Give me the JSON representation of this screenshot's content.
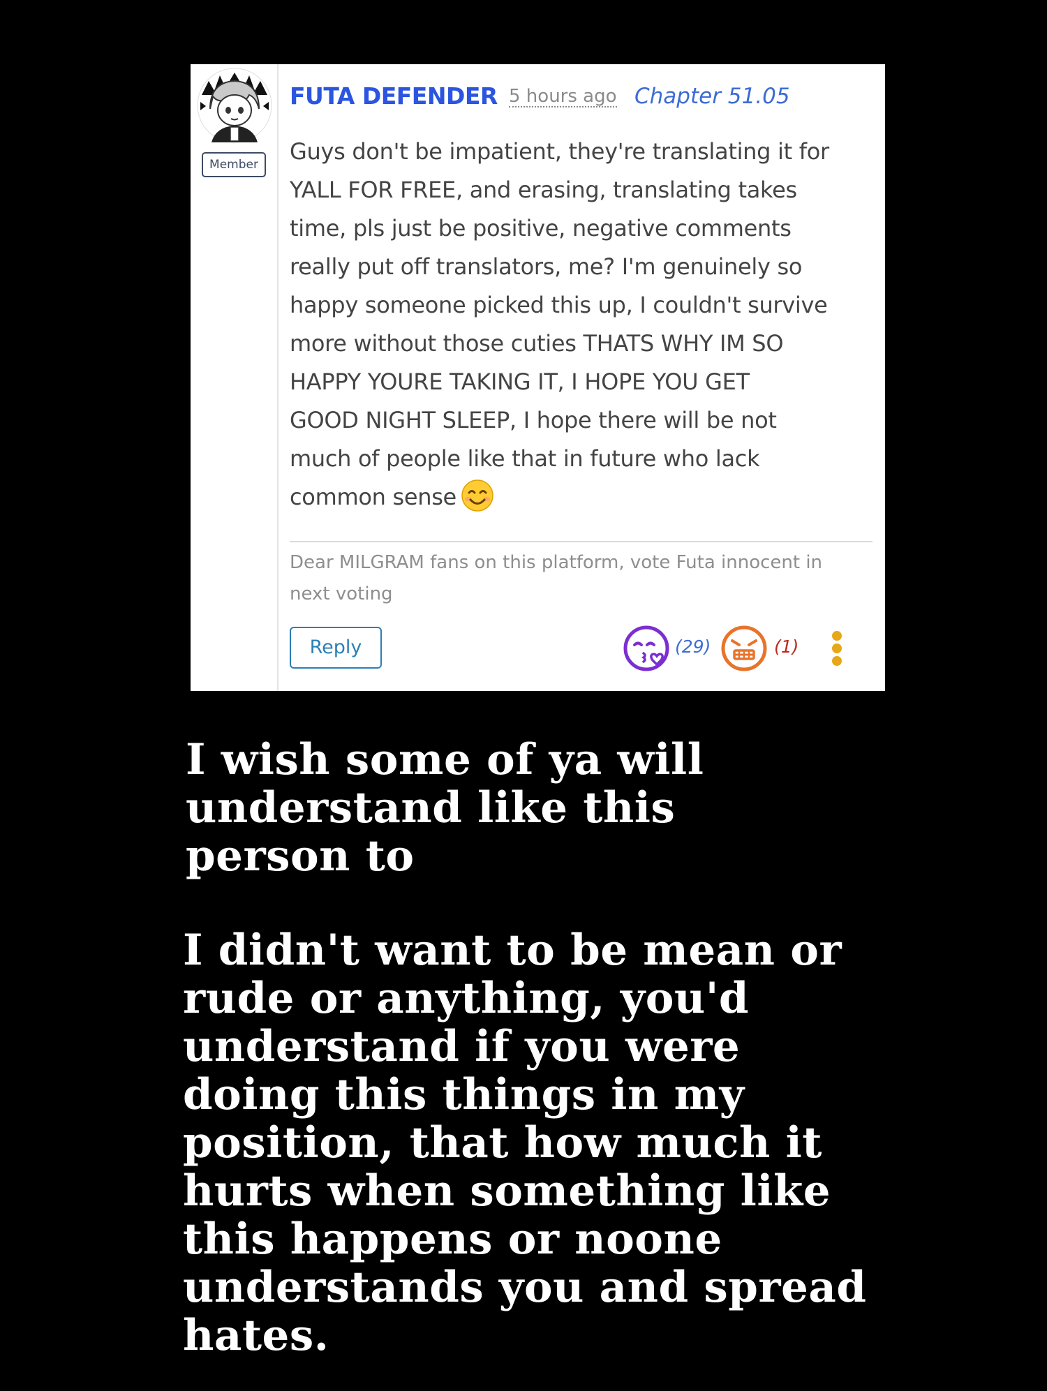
{
  "comment": {
    "username": "FUTA DEFENDER",
    "badge": "Member",
    "timestamp": "5 hours ago",
    "chapter": "Chapter 51.05",
    "body_lines": [
      "Guys don't be impatient, they're translating it for",
      "YALL FOR FREE, and erasing, translating takes",
      "time, pls just be positive, negative comments",
      "really put off translators, me? I'm genuinely so",
      "happy someone picked this up, I couldn't survive",
      "more without those cuties THATS WHY IM SO",
      "HAPPY YOURE TAKING IT, I HOPE YOU GET",
      "GOOD NIGHT SLEEP, I hope there will be not",
      "much of people like that in future who lack",
      "common sense"
    ],
    "signature_lines": [
      "Dear MILGRAM fans on this platform, vote Futa innocent in",
      "next voting"
    ],
    "reply_label": "Reply",
    "reactions": {
      "love": {
        "icon": "love-face-icon",
        "count": "(29)",
        "color": "#7b2fd0"
      },
      "angry": {
        "icon": "angry-face-icon",
        "count": "(1)",
        "color": "#e8742a",
        "count_color": "#c0281e"
      }
    },
    "more_icon": "vertical-dots-icon",
    "more_color": "#e6a817"
  },
  "captions": {
    "first_lines": [
      "I wish some of ya will",
      "understand like this",
      "person to"
    ],
    "second_lines": [
      "I didn't want to be mean or",
      "rude or anything, you'd",
      "understand if you were",
      "doing this things in my",
      "position, that how much it",
      "hurts when something like",
      "this happens or noone",
      "understands you and spread",
      "hates."
    ]
  },
  "colors": {
    "background": "#000000",
    "card": "#ffffff",
    "username": "#2b55e0",
    "chapter": "#3d6bd6",
    "reply_border": "#2b7fb5"
  }
}
